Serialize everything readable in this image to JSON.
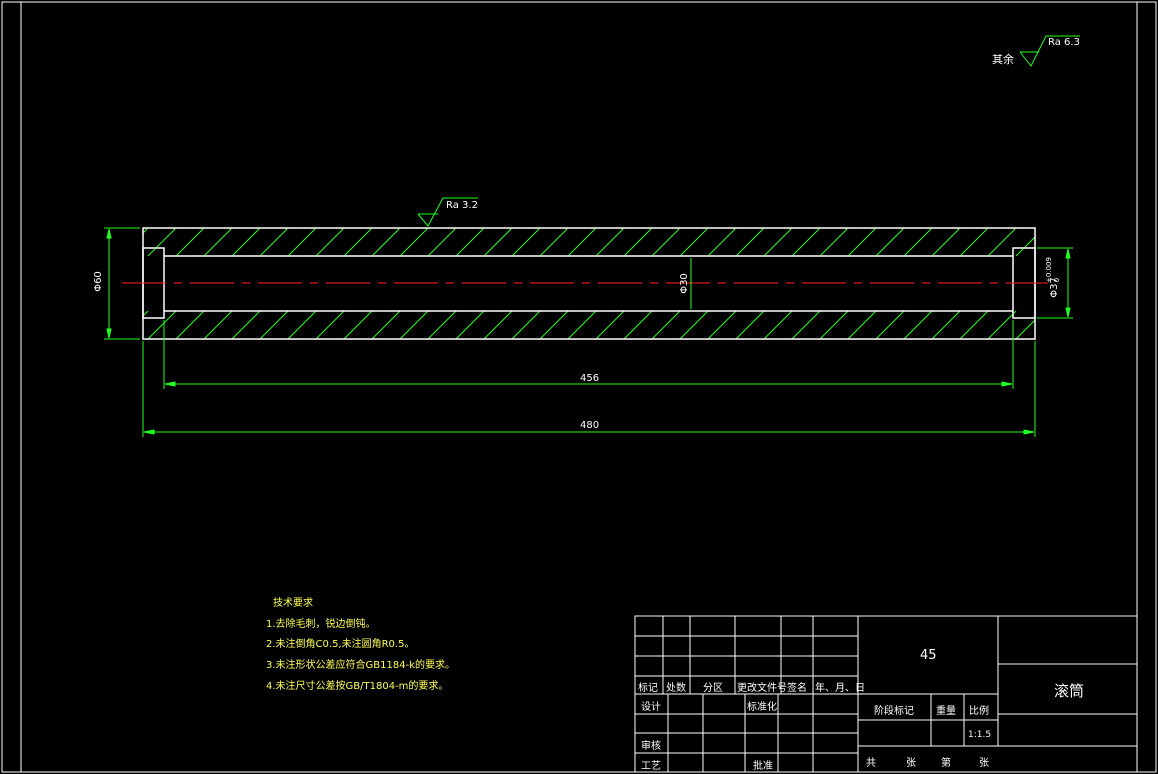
{
  "surface_finish": {
    "other_label": "其余",
    "other_value": "Ra 6.3",
    "bore_value": "Ra 3.2"
  },
  "dimensions": {
    "outer_diameter": "Φ60",
    "inner_diameter": "Φ30",
    "bearing_seat": "Φ37",
    "tol_upper": "+0.009",
    "tol_lower": "0",
    "inner_length": "456",
    "total_length": "480"
  },
  "tech_requirements": {
    "title": "技术要求",
    "items": [
      "1.去除毛刺，锐边倒钝。",
      "2.未注倒角C0.5,未注圆角R0.5。",
      "3.未注形状公差应符合GB1184-k的要求。",
      "4.未注尺寸公差按GB/T1804-m的要求。"
    ]
  },
  "title_block": {
    "material": "45",
    "part_name": "滚筒",
    "revision_headers": [
      "标记",
      "处数",
      "分区",
      "更改文件号",
      "签名",
      "年、月、日"
    ],
    "design": "设计",
    "standardize": "标准化",
    "review": "审核",
    "process": "工艺",
    "approve": "批准",
    "stage_mark": "阶段标记",
    "weight": "重量",
    "scale_label": "比例",
    "scale_value": "1:1.5",
    "total_sheets": "共",
    "sheets_unit1": "张",
    "sheet_no": "第",
    "sheets_unit2": "张"
  }
}
